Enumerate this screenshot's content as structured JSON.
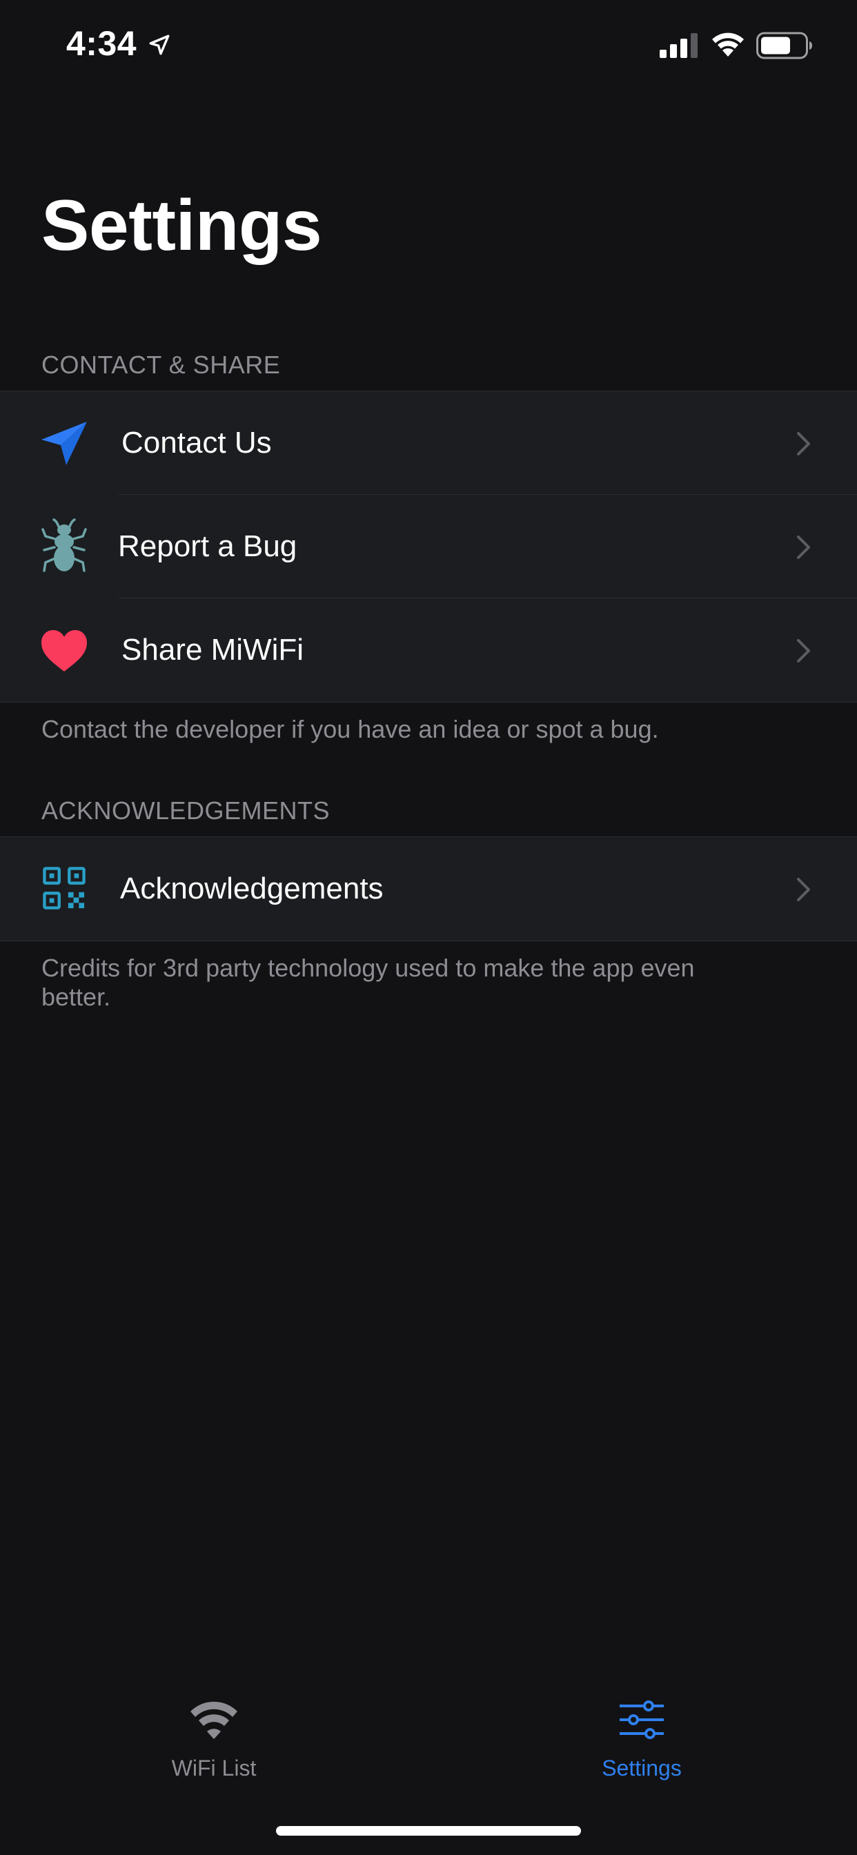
{
  "status_bar": {
    "time": "4:34",
    "location_icon": "location-arrow-icon",
    "signal_icon": "cellular-signal-icon",
    "wifi_icon": "wifi-icon",
    "battery_icon": "battery-icon"
  },
  "title": "Settings",
  "sections": [
    {
      "header": "CONTACT & SHARE",
      "footer": "Contact the developer if you have an idea or spot a bug.",
      "items": [
        {
          "label": "Contact Us",
          "icon": "paper-plane-icon",
          "icon_color": "#2f7bf5"
        },
        {
          "label": "Report a Bug",
          "icon": "bug-icon",
          "icon_color": "#6fa5a8"
        },
        {
          "label": "Share MiWiFi",
          "icon": "heart-icon",
          "icon_color": "#fb3b5c"
        }
      ]
    },
    {
      "header": "ACKNOWLEDGEMENTS",
      "footer": "Credits for 3rd party technology used to make the app even better.",
      "items": [
        {
          "label": "Acknowledgements",
          "icon": "qr-code-icon",
          "icon_color": "#2aa0c8"
        }
      ]
    }
  ],
  "tab_bar": {
    "tabs": [
      {
        "label": "WiFi List",
        "icon": "wifi-icon",
        "selected": false
      },
      {
        "label": "Settings",
        "icon": "sliders-icon",
        "selected": true
      }
    ],
    "active_color": "#2f80ed",
    "inactive_color": "#8d8d93"
  },
  "colors": {
    "background": "#121214",
    "cell_background": "#1b1d20",
    "separator": "#2c2e32",
    "secondary_text": "#8d8d93",
    "chevron": "#5c5d62"
  }
}
